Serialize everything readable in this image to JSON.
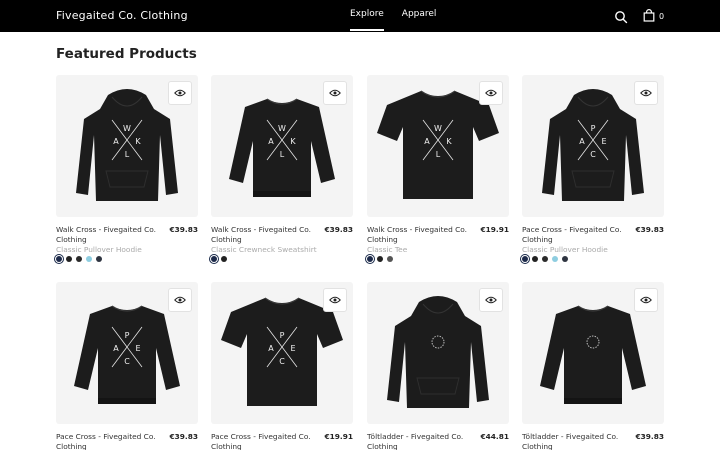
{
  "header": {
    "brand": "Fivegaited Co. Clothing",
    "nav": [
      {
        "label": "Explore",
        "active": true
      },
      {
        "label": "Apparel",
        "active": false
      }
    ],
    "search_icon": "search-icon",
    "cart_icon": "shopping-bag-icon",
    "cart_count": "0"
  },
  "main": {
    "section_title": "Featured Products",
    "products": [
      {
        "name": "Walk Cross - Fivegaited Co. Clothing",
        "price": "€39.83",
        "type": "Classic Pullover Hoodie",
        "garment": "hoodie",
        "print": "WALK",
        "swatches": [
          "#1d2a4a",
          "#222222",
          "#2b2b2b",
          "#8ecde0",
          "#2e3440"
        ]
      },
      {
        "name": "Walk Cross - Fivegaited Co. Clothing",
        "price": "€39.83",
        "type": "Classic Crewneck Sweatshirt",
        "garment": "sweatshirt",
        "print": "WALK",
        "swatches": [
          "#1d2a4a",
          "#222222"
        ]
      },
      {
        "name": "Walk Cross - Fivegaited Co. Clothing",
        "price": "€19.91",
        "type": "Classic Tee",
        "garment": "tee",
        "print": "WALK",
        "swatches": [
          "#1d2a4a",
          "#222222",
          "#555555"
        ]
      },
      {
        "name": "Pace Cross - Fivegaited Co. Clothing",
        "price": "€39.83",
        "type": "Classic Pullover Hoodie",
        "garment": "hoodie",
        "print": "PACE",
        "swatches": [
          "#1d2a4a",
          "#222222",
          "#2b2b2b",
          "#8ecde0",
          "#2e3440"
        ]
      },
      {
        "name": "Pace Cross - Fivegaited Co. Clothing",
        "price": "€39.83",
        "type": "",
        "garment": "sweatshirt",
        "print": "PACE",
        "swatches": []
      },
      {
        "name": "Pace Cross - Fivegaited Co. Clothing",
        "price": "€19.91",
        "type": "",
        "garment": "tee",
        "print": "PACE",
        "swatches": []
      },
      {
        "name": "Töltladder - Fivegaited Co. Clothing",
        "price": "€44.81",
        "type": "",
        "garment": "hoodie-plain",
        "print": "WREATH",
        "swatches": []
      },
      {
        "name": "Töltladder - Fivegaited Co. Clothing",
        "price": "€39.83",
        "type": "",
        "garment": "sweatshirt-plain",
        "print": "WREATH",
        "swatches": []
      }
    ]
  },
  "icons": {
    "quick_view": "eye-icon"
  },
  "colors": {
    "header_bg": "#000000",
    "garment": "#1c1c1c",
    "card_bg": "#f4f4f4"
  }
}
